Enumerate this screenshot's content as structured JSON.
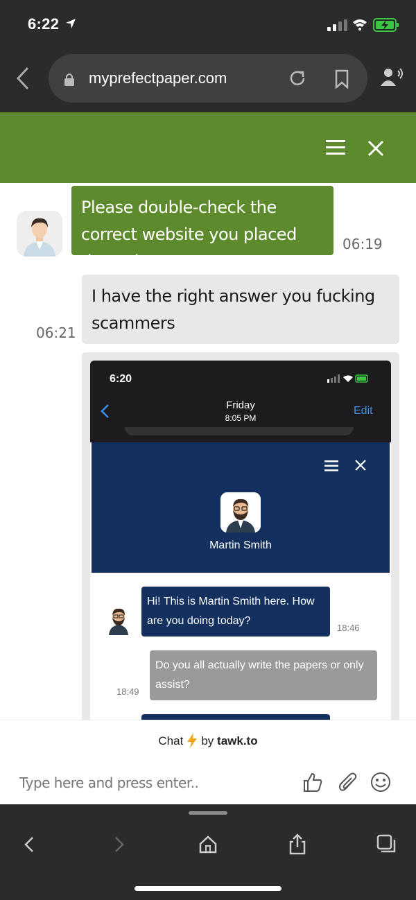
{
  "status_bar": {
    "time": "6:22"
  },
  "browser": {
    "url": "myprefectpaper.com"
  },
  "chat": {
    "messages": [
      {
        "sender": "agent",
        "text": "Please double-check the correct website you placed the order.",
        "time": "06:19"
      },
      {
        "sender": "visitor",
        "text": "I have the right answer you fucking scammers",
        "time": "06:21"
      }
    ],
    "screenshot": {
      "time": "6:20",
      "day": "Friday",
      "date": "8:05 PM",
      "edit": "Edit",
      "agent_name": "Martin Smith",
      "messages": [
        {
          "sender": "agent",
          "text": "Hi! This is Martin Smith here. How are you doing today?",
          "time": "18:46"
        },
        {
          "sender": "visitor",
          "text": "Do you all actually write the papers or only assist?",
          "time": "18:49"
        }
      ]
    },
    "footer": {
      "chat_label": "Chat",
      "by_label": "by",
      "brand": "tawk.to"
    },
    "input_placeholder": "Type here and press enter.."
  },
  "colors": {
    "header_green": "#5e8a2e",
    "navy": "#13305f",
    "browser_chrome": "#2b2b2d"
  },
  "icons": [
    "location-arrow-icon",
    "signal-icon",
    "wifi-icon",
    "battery-icon",
    "back-icon",
    "lock-icon",
    "reload-icon",
    "bookmark-icon",
    "reader-icon",
    "menu-icon",
    "close-icon",
    "thumbs-up-icon",
    "paperclip-icon",
    "smiley-icon",
    "forward-icon",
    "home-icon",
    "share-icon",
    "tabs-icon"
  ]
}
